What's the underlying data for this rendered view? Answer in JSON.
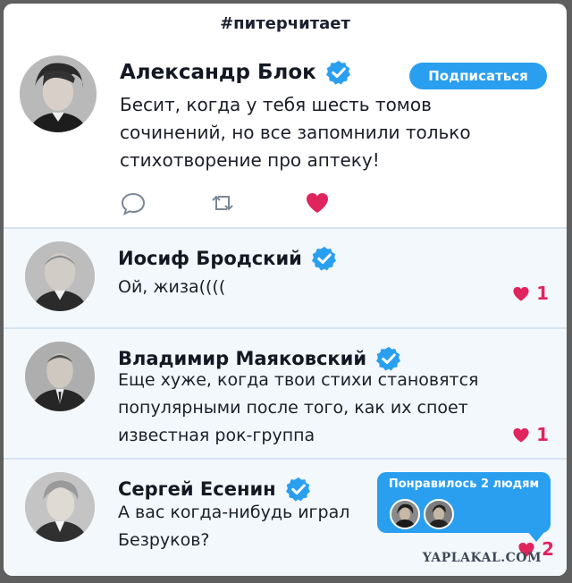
{
  "header": {
    "hashtag": "#питерчитает"
  },
  "main_post": {
    "author": "Александр Блок",
    "verified": true,
    "subscribe_label": "Подписаться",
    "text": "Бесит, когда у тебя шесть томов\nсочинений, но все запомнили только\nстихотворение про аптеку!",
    "actions": [
      "comment-icon",
      "retweet-icon",
      "heart-icon"
    ]
  },
  "replies": [
    {
      "author": "Иосиф Бродский",
      "verified": true,
      "text": "Ой, жиза((((",
      "likes": "1"
    },
    {
      "author": "Владимир Маяковский",
      "verified": true,
      "text": "Еще хуже, когда твои стихи становятся\nпопулярными после того, как их споет\nизвестная рок-группа",
      "likes": "1"
    },
    {
      "author": "Сергей Есенин",
      "verified": true,
      "text": "А вас когда-нибудь играл\nБезруков?",
      "likes": "2",
      "liked_by": {
        "title": "Понравилось 2 людям",
        "avatars": [
          "avatar-pushkin",
          "avatar-lermontov"
        ]
      }
    }
  ],
  "watermark": "YAPLAKAL.COM",
  "colors": {
    "accent": "#2a9ff0",
    "like": "#e0245e",
    "reply_bg": "#f3f8fc",
    "page_bg": "#5f5f5f"
  }
}
